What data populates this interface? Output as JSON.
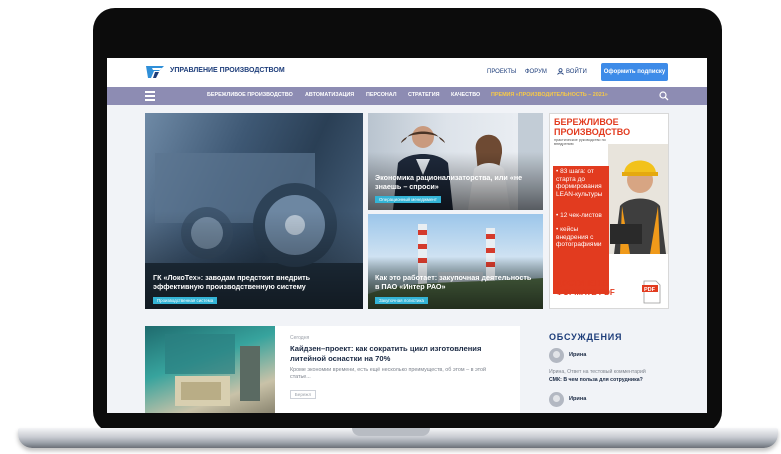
{
  "header": {
    "logo_text": "УПРАВЛЕНИЕ ПРОИЗВОДСТВОМ",
    "links": [
      "ПРОЕКТЫ",
      "ФОРУМ"
    ],
    "login_label": "ВОЙТИ",
    "subscribe_label": "Оформить подписку"
  },
  "nav": {
    "items": [
      "БЕРЕЖЛИВОЕ ПРОИЗВОДСТВО",
      "АВТОМАТИЗАЦИЯ",
      "ПЕРСОНАЛ",
      "СТРАТЕГИЯ",
      "КАЧЕСТВО"
    ],
    "highlight": "ПРЕМИЯ «ПРОИЗВОДИТЕЛЬНОСТЬ – 2021»"
  },
  "featured": [
    {
      "title": "ГК «ЛокоТех»: заводам предстоит внедрить эффективную производственную систему",
      "tag": "Производственная система"
    },
    {
      "title": "Экономика рационализаторства, или «не знаешь – спроси»",
      "tag": "Операционный менеджмент"
    },
    {
      "title": "Как это работает: закупочная деятельность в ПАО «Интер РАО»",
      "tag": "Закупочная логистика"
    }
  ],
  "ad": {
    "title_line1": "БЕРЕЖЛИВОЕ",
    "title_line2": "ПРОИЗВОДСТВО",
    "subtitle": "практическое руководство по внедрению",
    "bullets": [
      "83 шага: от старта до формирования LEAN-культуры",
      "12 чек-листов",
      "кейсы внедрения с фотографиями"
    ],
    "cta": "ДОСТУПЕН В ФОРМАТЕ PDF",
    "pdf_label": "PDF"
  },
  "article": {
    "category": "Сегодня",
    "title": "Кайдзен–проект: как сократить цикл изготовления литейной оснастки на 70%",
    "text": "Кроме экономии времени, есть ещё несколько преимуществ, об этом – в этой статье...",
    "button": "Бережл"
  },
  "discussions": {
    "title": "ОБСУЖДЕНИЯ",
    "comments": [
      {
        "name": "Ирина",
        "text": "Ирина, Ответ на тестовый комментарий",
        "link": "СМК: В чем польза для сотрудника?"
      },
      {
        "name": "Ирина"
      }
    ]
  },
  "colors": {
    "brand": "#1d3d7a",
    "nav_bg": "#8d8cb3",
    "accent": "#3d8be8",
    "tag": "#34b4d6",
    "ad_red": "#e23b1f"
  }
}
